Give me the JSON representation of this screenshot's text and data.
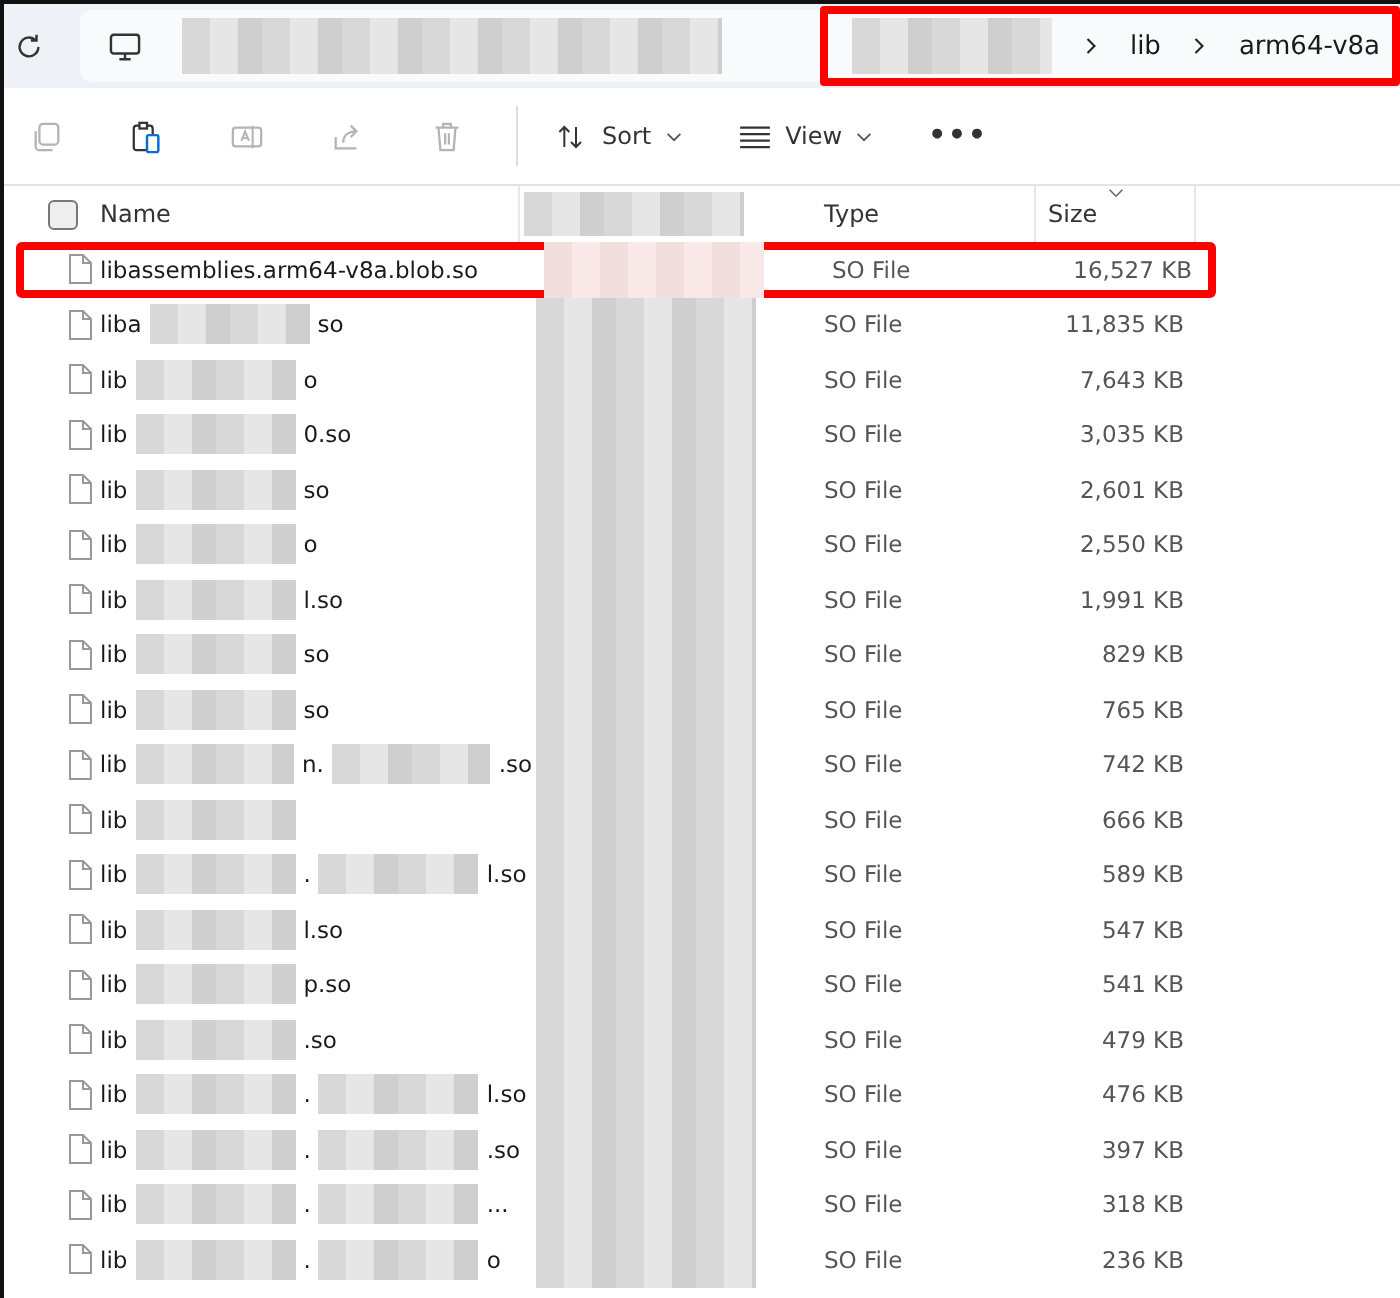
{
  "address_bar": {
    "annotated": true,
    "crumbs": [
      {
        "label": "lib"
      },
      {
        "label": "arm64-v8a"
      }
    ]
  },
  "toolbar": {
    "items": [
      {
        "kind": "copy",
        "disabled": true
      },
      {
        "kind": "paste",
        "disabled": false
      },
      {
        "kind": "rename",
        "disabled": true
      },
      {
        "kind": "share",
        "disabled": true
      },
      {
        "kind": "delete",
        "disabled": true
      },
      {
        "kind": "sort",
        "label": "Sort",
        "disabled": false
      },
      {
        "kind": "view",
        "label": "View",
        "disabled": false
      },
      {
        "kind": "more",
        "label": "•••",
        "disabled": false
      }
    ]
  },
  "table": {
    "select_all": {
      "checked": false
    },
    "columns": [
      {
        "label": "Name"
      },
      {
        "label": "Type"
      },
      {
        "label": "Size",
        "sorted": true
      }
    ],
    "rows": [
      {
        "name_parts": [
          {
            "text": "libassemblies.arm64-v8a.blob.so"
          }
        ],
        "type": "SO File",
        "size": "16,527 KB",
        "highlighted": true
      },
      {
        "name_parts": [
          {
            "text": "liba"
          },
          {
            "kind": "redacted"
          },
          {
            "text": "so"
          }
        ],
        "type": "SO File",
        "size": "11,835 KB",
        "highlighted": false
      },
      {
        "name_parts": [
          {
            "text": "lib"
          },
          {
            "kind": "redacted"
          },
          {
            "text": "o"
          }
        ],
        "type": "SO File",
        "size": "7,643 KB",
        "highlighted": false
      },
      {
        "name_parts": [
          {
            "text": "lib"
          },
          {
            "kind": "redacted"
          },
          {
            "text": "0.so"
          }
        ],
        "type": "SO File",
        "size": "3,035 KB",
        "highlighted": false
      },
      {
        "name_parts": [
          {
            "text": "lib"
          },
          {
            "kind": "redacted"
          },
          {
            "text": "so"
          }
        ],
        "type": "SO File",
        "size": "2,601 KB",
        "highlighted": false
      },
      {
        "name_parts": [
          {
            "text": "lib"
          },
          {
            "kind": "redacted"
          },
          {
            "text": "o"
          }
        ],
        "type": "SO File",
        "size": "2,550 KB",
        "highlighted": false
      },
      {
        "name_parts": [
          {
            "text": "lib"
          },
          {
            "kind": "redacted"
          },
          {
            "text": "l.so"
          }
        ],
        "type": "SO File",
        "size": "1,991 KB",
        "highlighted": false
      },
      {
        "name_parts": [
          {
            "text": "lib"
          },
          {
            "kind": "redacted"
          },
          {
            "text": "so"
          }
        ],
        "type": "SO File",
        "size": "829 KB",
        "highlighted": false
      },
      {
        "name_parts": [
          {
            "text": "lib"
          },
          {
            "kind": "redacted"
          },
          {
            "text": "so"
          }
        ],
        "type": "SO File",
        "size": "765 KB",
        "highlighted": false
      },
      {
        "name_parts": [
          {
            "text": "lib"
          },
          {
            "kind": "redacted"
          },
          {
            "text": "n."
          },
          {
            "kind": "redacted"
          },
          {
            "text": ".so"
          }
        ],
        "type": "SO File",
        "size": "742 KB",
        "highlighted": false
      },
      {
        "name_parts": [
          {
            "text": "lib"
          },
          {
            "kind": "redacted"
          }
        ],
        "type": "SO File",
        "size": "666 KB",
        "highlighted": false
      },
      {
        "name_parts": [
          {
            "text": "lib"
          },
          {
            "kind": "redacted"
          },
          {
            "text": "."
          },
          {
            "kind": "redacted"
          },
          {
            "text": "l.so"
          }
        ],
        "type": "SO File",
        "size": "589 KB",
        "highlighted": false
      },
      {
        "name_parts": [
          {
            "text": "lib"
          },
          {
            "kind": "redacted"
          },
          {
            "text": "l.so"
          }
        ],
        "type": "SO File",
        "size": "547 KB",
        "highlighted": false
      },
      {
        "name_parts": [
          {
            "text": "lib"
          },
          {
            "kind": "redacted"
          },
          {
            "text": "p.so"
          }
        ],
        "type": "SO File",
        "size": "541 KB",
        "highlighted": false
      },
      {
        "name_parts": [
          {
            "text": "lib"
          },
          {
            "kind": "redacted"
          },
          {
            "text": ".so"
          }
        ],
        "type": "SO File",
        "size": "479 KB",
        "highlighted": false
      },
      {
        "name_parts": [
          {
            "text": "lib"
          },
          {
            "kind": "redacted"
          },
          {
            "text": "."
          },
          {
            "kind": "redacted"
          },
          {
            "text": "l.so"
          }
        ],
        "type": "SO File",
        "size": "476 KB",
        "highlighted": false
      },
      {
        "name_parts": [
          {
            "text": "lib"
          },
          {
            "kind": "redacted"
          },
          {
            "text": "."
          },
          {
            "kind": "redacted"
          },
          {
            "text": ".so"
          }
        ],
        "type": "SO File",
        "size": "397 KB",
        "highlighted": false
      },
      {
        "name_parts": [
          {
            "text": "lib"
          },
          {
            "kind": "redacted"
          },
          {
            "text": "."
          },
          {
            "kind": "redacted"
          },
          {
            "text": "..."
          }
        ],
        "type": "SO File",
        "size": "318 KB",
        "highlighted": false
      },
      {
        "name_parts": [
          {
            "text": "lib"
          },
          {
            "kind": "redacted"
          },
          {
            "text": "."
          },
          {
            "kind": "redacted"
          },
          {
            "text": "o"
          }
        ],
        "type": "SO File",
        "size": "236 KB",
        "highlighted": false
      }
    ]
  }
}
